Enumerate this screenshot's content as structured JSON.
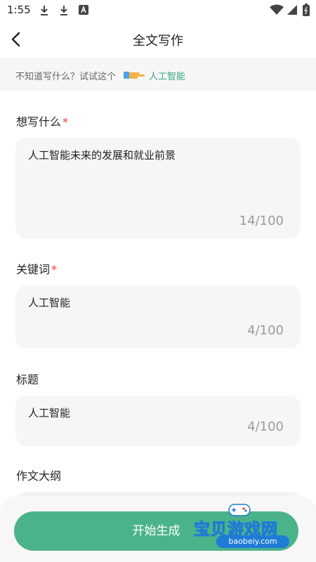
{
  "status_bar": {
    "time": "1:55"
  },
  "header": {
    "title": "全文写作"
  },
  "hint": {
    "text": "不知道写什么？试试这个",
    "suggestion": "人工智能"
  },
  "fields": [
    {
      "label": "想写什么",
      "required": "*",
      "value": "人工智能未来的发展和就业前景",
      "count": "14/100"
    },
    {
      "label": "关键词",
      "required": "*",
      "value": "人工智能",
      "count": "4/100"
    },
    {
      "label": "标题",
      "required": "",
      "value": "人工智能",
      "count": "4/100"
    },
    {
      "label": "作文大纲",
      "required": "",
      "value": "",
      "count": ""
    }
  ],
  "actions": {
    "generate_label": "开始生成"
  },
  "watermark": {
    "title": "宝贝游戏网",
    "url": "baobeiy.com"
  },
  "colors": {
    "accent": "#4bb38a",
    "link": "#37a883",
    "required": "#e53935",
    "field_bg": "#f6f6f6"
  },
  "icons": [
    "download-icon",
    "download-icon",
    "a-letter-icon",
    "wifi-icon",
    "signal-icon",
    "battery-icon",
    "back-arrow-icon",
    "pointing-hand-icon"
  ]
}
